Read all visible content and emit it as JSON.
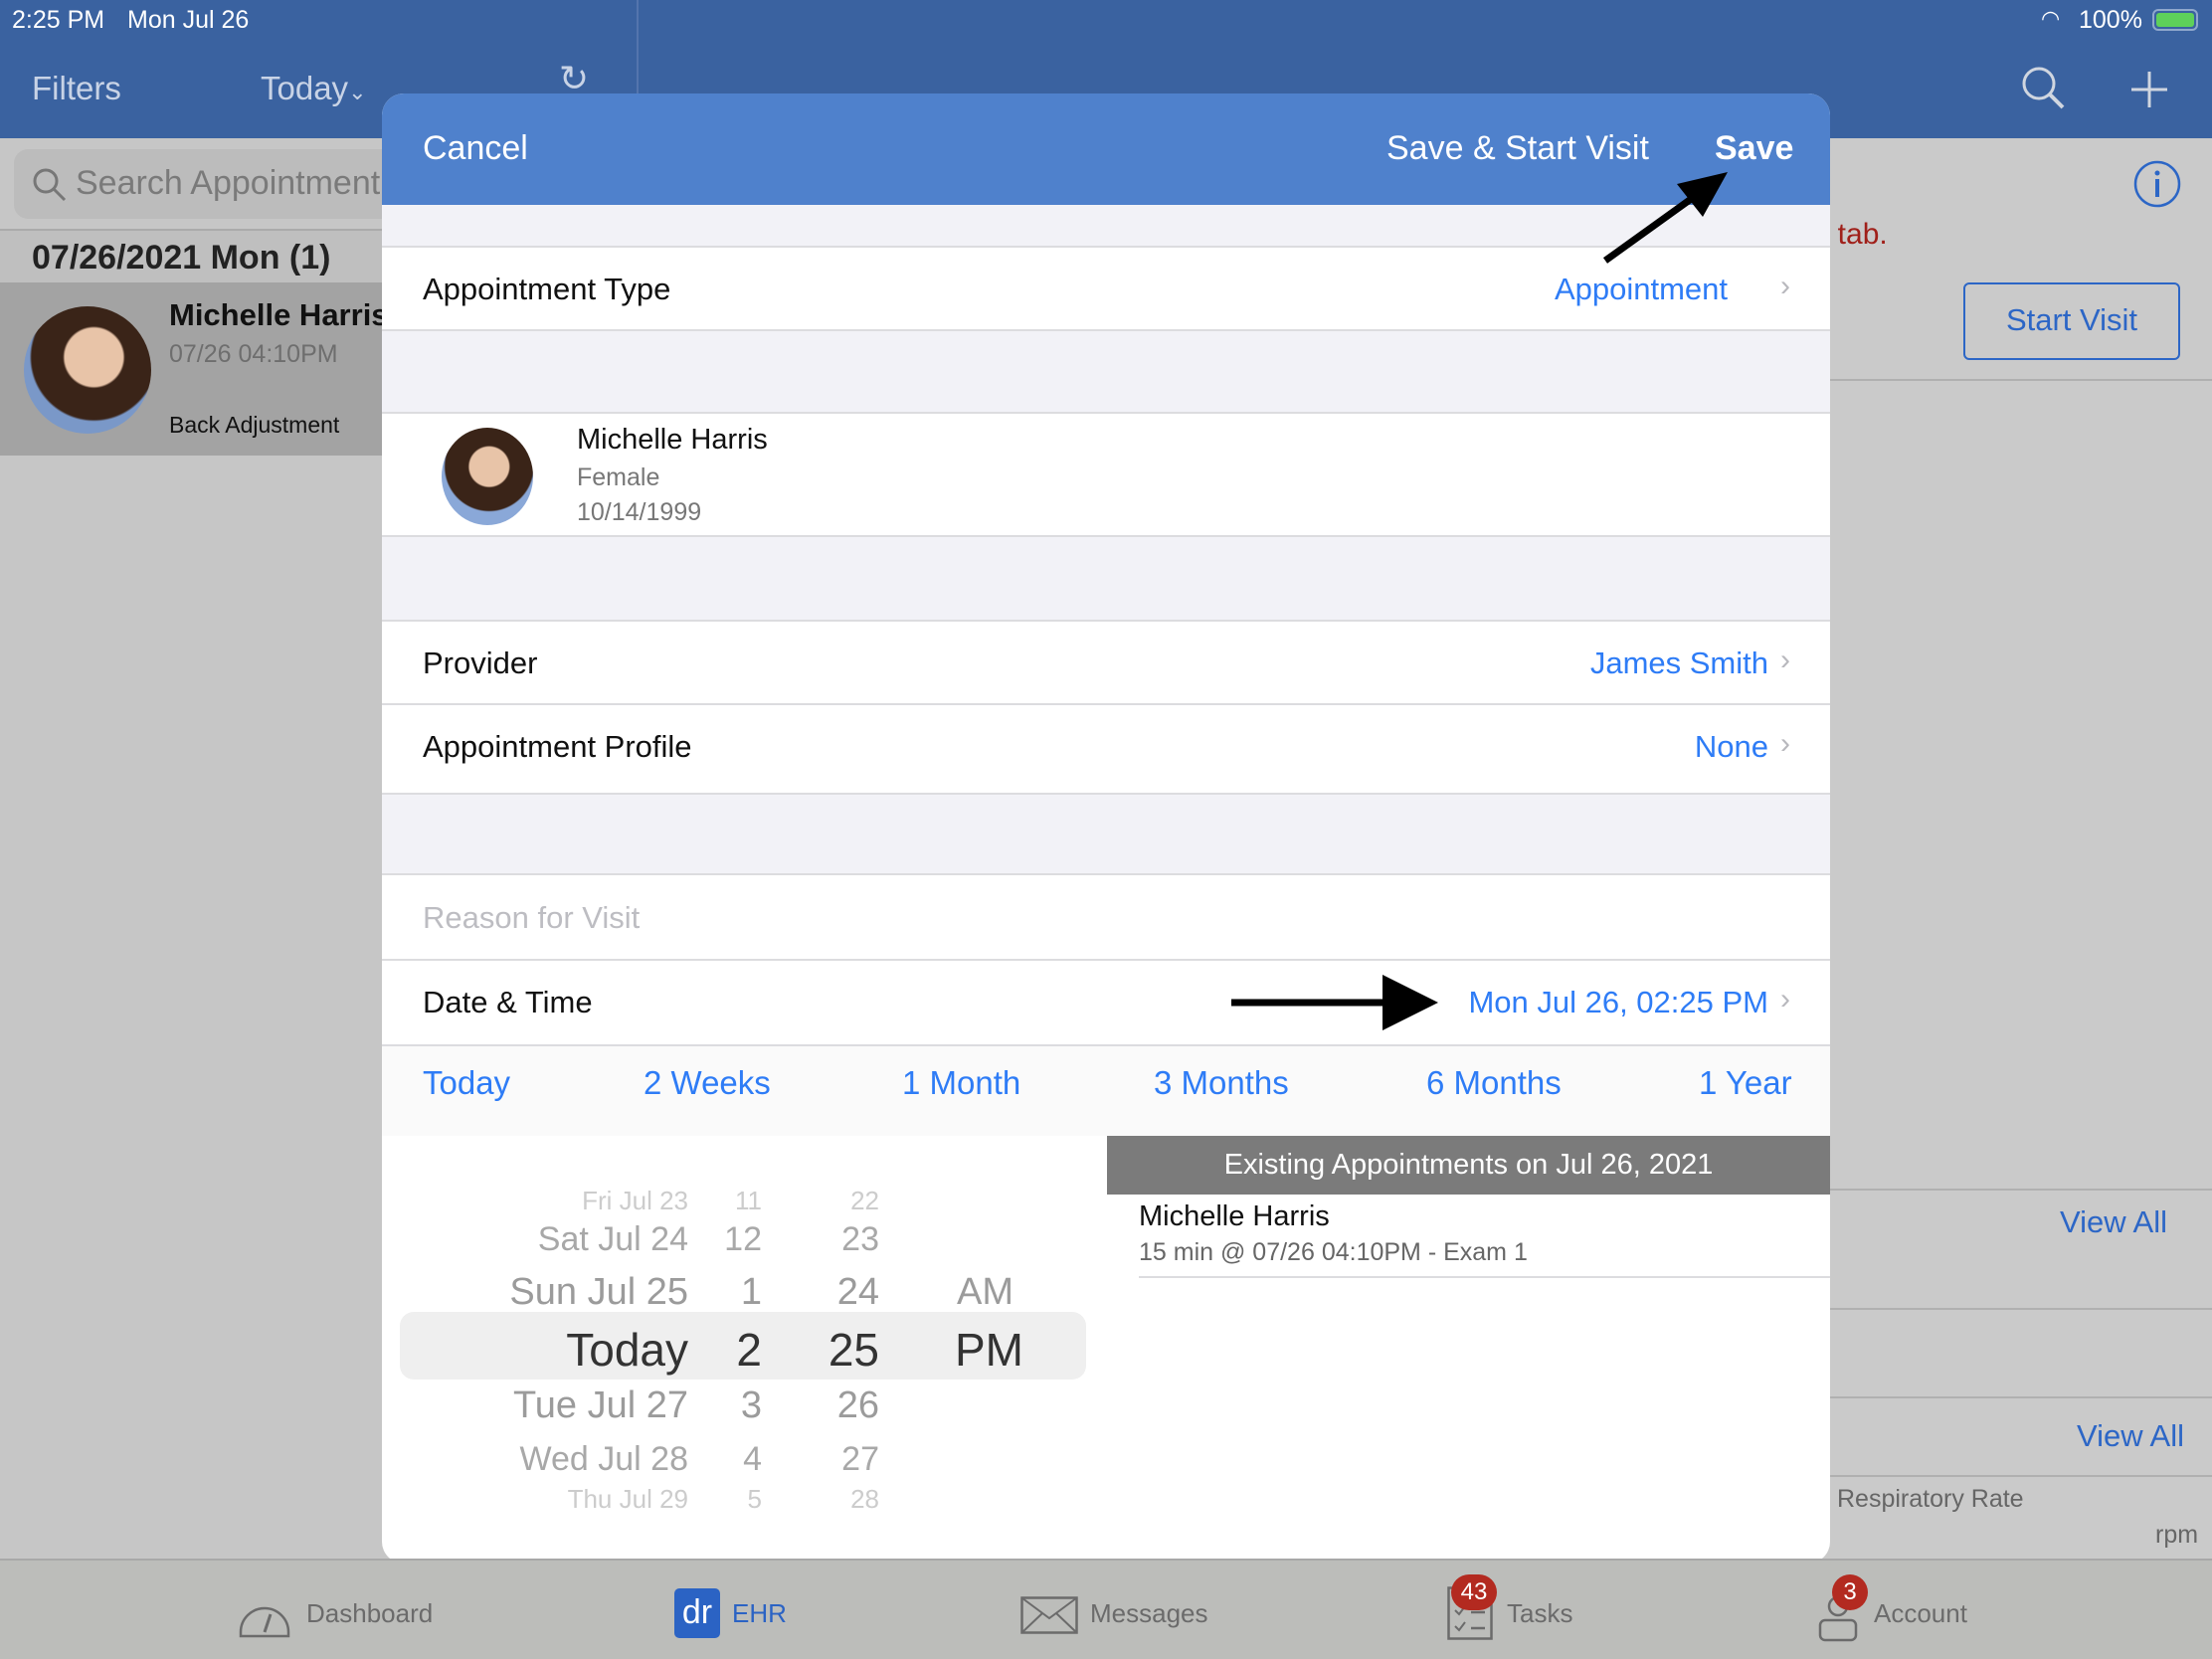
{
  "status_bar": {
    "time": "2:25 PM",
    "date": "Mon Jul 26",
    "battery": "100%"
  },
  "left_nav": {
    "filters": "Filters",
    "today": "Today",
    "today_caret": "⌄"
  },
  "search": {
    "placeholder": "Search Appointment"
  },
  "list": {
    "date_header": "07/26/2021 Mon (1)",
    "items": [
      {
        "name": "Michelle Harris",
        "time": "07/26 04:10PM",
        "reason": "Back Adjustment"
      }
    ]
  },
  "right_pane": {
    "message_fragment": "t tab.",
    "start_visit": "Start Visit",
    "view_all_1": "View All",
    "view_all_2": "View All",
    "vital_label": "Respiratory Rate",
    "vital_unit": "rpm"
  },
  "modal": {
    "cancel": "Cancel",
    "save_start": "Save & Start Visit",
    "save": "Save",
    "appointment_type": {
      "label": "Appointment Type",
      "value": "Appointment"
    },
    "patient": {
      "name": "Michelle Harris",
      "gender": "Female",
      "dob": "10/14/1999"
    },
    "provider": {
      "label": "Provider",
      "value": "James Smith"
    },
    "profile": {
      "label": "Appointment Profile",
      "value": "None"
    },
    "reason_placeholder": "Reason for Visit",
    "date_time": {
      "label": "Date & Time",
      "value": "Mon Jul 26, 02:25 PM"
    },
    "quick_ranges": [
      "Today",
      "2 Weeks",
      "1 Month",
      "3 Months",
      "6 Months",
      "1 Year"
    ],
    "picker": {
      "days": [
        "Fri Jul 23",
        "Sat Jul 24",
        "Sun Jul 25",
        "Today",
        "Tue Jul 27",
        "Wed Jul 28",
        "Thu Jul 29"
      ],
      "hours": [
        "11",
        "12",
        "1",
        "2",
        "3",
        "4",
        "5"
      ],
      "minutes": [
        "22",
        "23",
        "24",
        "25",
        "26",
        "27",
        "28"
      ],
      "ampm": [
        "AM",
        "PM"
      ]
    },
    "existing": {
      "header": "Existing Appointments on Jul 26, 2021",
      "items": [
        {
          "name": "Michelle Harris",
          "detail": "15 min @ 07/26 04:10PM - Exam 1"
        }
      ]
    }
  },
  "tabbar": {
    "items": [
      "Dashboard",
      "EHR",
      "Messages",
      "Tasks",
      "Account"
    ],
    "ehr_logo": "dr",
    "tasks_badge": "43",
    "account_badge": "3",
    "active": "EHR"
  },
  "colors": {
    "nav": "#3a62a0",
    "modal_header": "#4f81cc",
    "link": "#2e7cf6",
    "badge": "#b32a20",
    "error": "#a0201a"
  }
}
